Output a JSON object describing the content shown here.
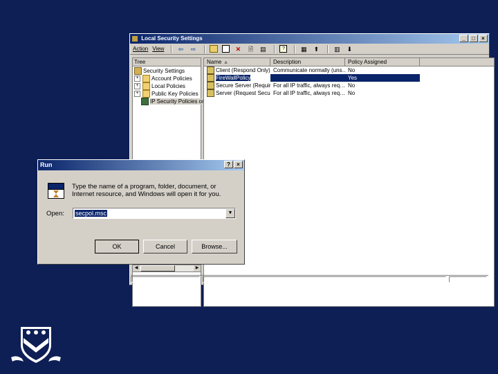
{
  "lsp": {
    "title": "Local Security Settings",
    "menu": [
      "Action",
      "View"
    ],
    "toolbar_icons": [
      "back-icon",
      "forward-icon",
      "up-folder-icon",
      "show-hide-tree-icon",
      "delete-icon",
      "properties-icon",
      "export-list-icon",
      "help-icon",
      "add-icon",
      "assign-icon",
      "manage-filters-icon",
      "unassign-icon"
    ],
    "tree_header": "Tree",
    "tree": [
      {
        "label": "Security Settings",
        "level": 0
      },
      {
        "label": "Account Policies",
        "level": 1
      },
      {
        "label": "Local Policies",
        "level": 1
      },
      {
        "label": "Public Key Policies",
        "level": 1
      },
      {
        "label": "IP Security Policies on",
        "level": 1,
        "selected": true
      }
    ],
    "columns": [
      "Name",
      "Description",
      "Policy Assigned"
    ],
    "rows": [
      {
        "name": "Client (Respond Only)",
        "description": "Communicate normally (uns…",
        "assigned": "No",
        "selected": false
      },
      {
        "name": "FireWallPolicy",
        "description": "",
        "assigned": "Yes",
        "selected": true
      },
      {
        "name": "Secure Server (Requir…",
        "description": "For all IP traffic, always req…",
        "assigned": "No",
        "selected": false
      },
      {
        "name": "Server (Request Secu…",
        "description": "For all IP traffic, always req…",
        "assigned": "No",
        "selected": false
      }
    ]
  },
  "run": {
    "title": "Run",
    "prompt": "Type the name of a program, folder, document, or Internet resource, and Windows will open it for you.",
    "open_label": "Open:",
    "open_value": "secpol.msc",
    "ok_label": "OK",
    "cancel_label": "Cancel",
    "browse_label": "Browse..."
  },
  "colors": {
    "background": "#0d1f55",
    "selection": "#0a246a"
  }
}
